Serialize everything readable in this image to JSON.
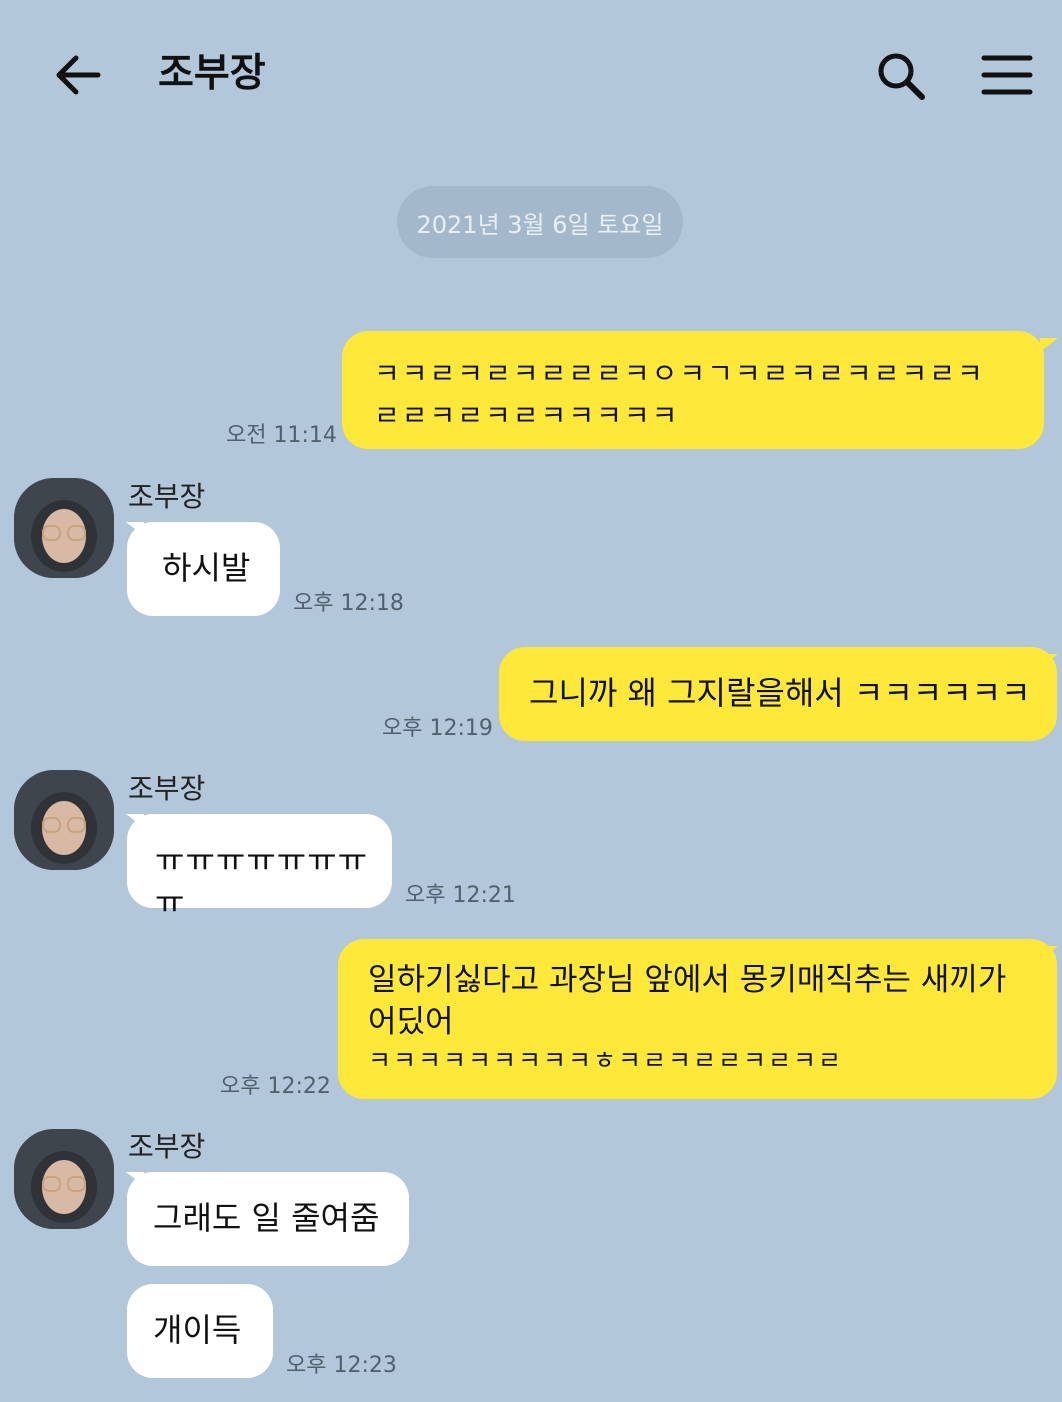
{
  "header": {
    "title": "조부장",
    "icons": [
      "back-arrow-icon",
      "search-icon",
      "menu-icon"
    ]
  },
  "date_divider": "2021년 3월 6일 토요일",
  "colors": {
    "background": "#b2c7da",
    "my_bubble": "#fee93a",
    "their_bubble": "#ffffff"
  },
  "messages": [
    {
      "from": "me",
      "lines": [
        "ㅋㅋㄹㅋㄹㅋㄹㄹㄹㅋㅇㅋㄱㅋㄹㅋㄹㅋㄹㅋㄹㅋ",
        "ㄹㄹㅋㄹㅋㄹㅋㅋㅋㅋㅋ"
      ],
      "time": "오전 11:14"
    },
    {
      "from": "them",
      "sender": "조부장",
      "text": "하시발",
      "time": "오후 12:18"
    },
    {
      "from": "me",
      "text": "그니까 왜 그지랄을해서 ㅋㅋㅋㅋㅋㅋ",
      "time": "오후 12:19"
    },
    {
      "from": "them",
      "sender": "조부장",
      "text": "ㅠㅠㅠㅠㅠㅠㅠㅠ",
      "time": "오후 12:21"
    },
    {
      "from": "me",
      "lines": [
        "일하기싫다고 과장님 앞에서 몽키매직추는 새끼가",
        "어딨어",
        "ㅋㅋㅋㅋㅋㅋㅋㅋㅋㅎㅋㄹㅋㄹㄹㅋㄹㅋㄹ"
      ],
      "time": "오후 12:22"
    },
    {
      "from": "them",
      "sender": "조부장",
      "text": "그래도 일 줄여줌",
      "time": ""
    },
    {
      "from": "them",
      "text": "개이득",
      "time": "오후 12:23"
    }
  ]
}
